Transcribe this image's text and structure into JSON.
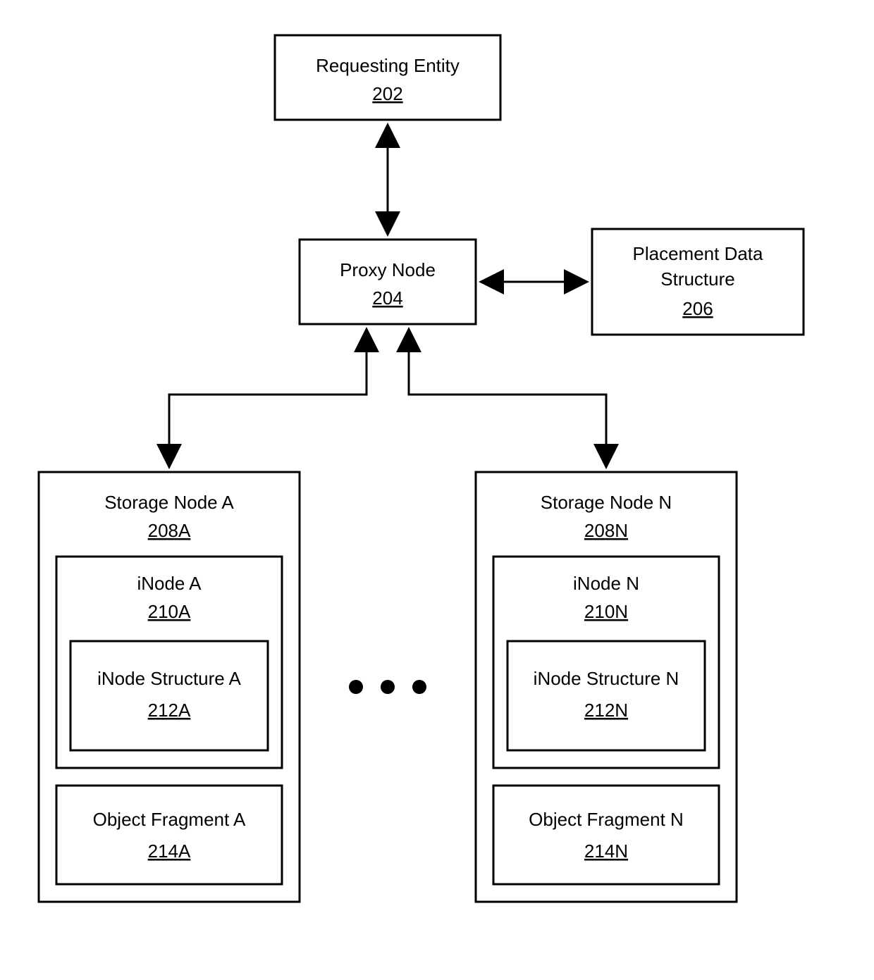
{
  "requesting_entity": {
    "label": "Requesting Entity",
    "num": "202"
  },
  "proxy_node": {
    "label": "Proxy Node",
    "num": "204"
  },
  "placement": {
    "label1": "Placement Data",
    "label2": "Structure",
    "num": "206"
  },
  "storage_a": {
    "label": "Storage Node A",
    "num": "208A",
    "inode": {
      "label": "iNode A",
      "num": "210A"
    },
    "inode_struct": {
      "label": "iNode Structure A",
      "num": "212A"
    },
    "frag": {
      "label": "Object Fragment A",
      "num": "214A"
    }
  },
  "storage_n": {
    "label": "Storage Node N",
    "num": "208N",
    "inode": {
      "label": "iNode N",
      "num": "210N"
    },
    "inode_struct": {
      "label": "iNode Structure N",
      "num": "212N"
    },
    "frag": {
      "label": "Object Fragment N",
      "num": "214N"
    }
  }
}
